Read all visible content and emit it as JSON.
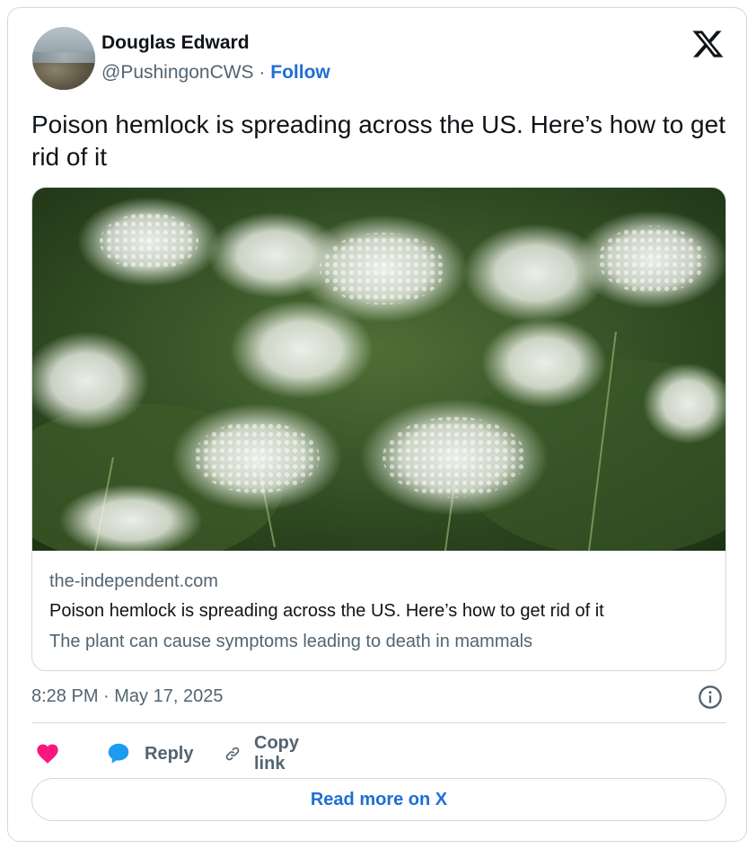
{
  "author": {
    "name": "Douglas Edward",
    "handle": "@PushingonCWS",
    "separator": "·",
    "follow_label": "Follow"
  },
  "brand_icon": "x-logo-icon",
  "tweet": {
    "text": "Poison hemlock is spreading across the US. Here’s how to get rid of it"
  },
  "link_card": {
    "image": "white-hemlock-flowers-photo",
    "domain": "the-independent.com",
    "title": "Poison hemlock is spreading across the US. Here’s how to get rid of it",
    "description": "The plant can cause symptoms leading to death in mammals"
  },
  "meta": {
    "timestamp": "8:28 PM · May 17, 2025",
    "info_icon": "info-icon"
  },
  "actions": {
    "like_icon": "heart-icon",
    "reply_label": "Reply",
    "reply_icon": "speech-bubble-icon",
    "copy_label": "Copy link",
    "copy_icon": "link-icon"
  },
  "read_more_label": "Read more on X",
  "colors": {
    "accent": "#1d6fd6",
    "heart": "#f91880",
    "reply": "#1d9bf0",
    "muted": "#536471",
    "border": "#cfd9de"
  }
}
